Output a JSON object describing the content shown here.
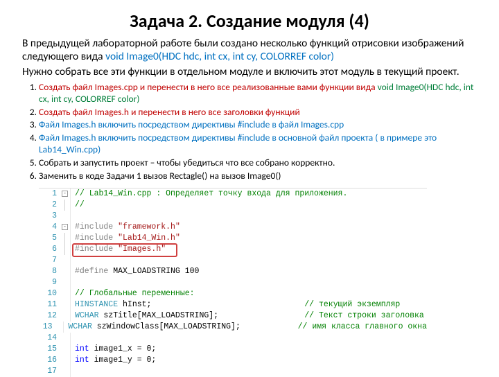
{
  "title": "Задача 2. Создание модуля (4)",
  "intro_part1": "В предыдущей лабораторной работе были создано несколько функций отрисовки изображений следующего вида ",
  "intro_sig": "void Image0(HDC hdc, int cx, int cy, COLORREF color)",
  "intro_part2": "Нужно собрать все эти функции в отдельном модуле и включить этот модуль в текущий проект.",
  "steps": [
    {
      "a": "Создать файл Images.cpp и перенести в него все реализованные вами функции вида ",
      "b": "void Image0(HDC hdc, int cx, int cy, COLORREF color)",
      "cls": "txt-red",
      "bcls": "txt-green"
    },
    {
      "a": "Создать файл Images.h и перенести в него все заголовки функций",
      "cls": "txt-red"
    },
    {
      "a": "Файл Images.h включить посредством директивы #include в файл Images.cpp",
      "cls": "txt-blue"
    },
    {
      "a": "Файл Images.h включить посредством директивы #include в основной файл проекта ( в примере это Lab14_Win.cpp)",
      "cls": "txt-blue"
    },
    {
      "a": "Собрать и запустить проект – чтобы убедиться что все собрано корректно.",
      "cls": "txt-black"
    },
    {
      "a": "Заменить в коде Задачи 1 вызов Rectagle() на вызов Image0()",
      "cls": "txt-black"
    }
  ],
  "chart_data": {
    "type": "table",
    "title": "Code editor snippet – Lab14_Win.cpp",
    "highlight_line": 6,
    "lines": [
      {
        "n": 1,
        "fold": "minus",
        "html": "<span class='c-comment'>// Lab14_Win.cpp : Определяет точку входа для приложения.</span>"
      },
      {
        "n": 2,
        "fold": "v",
        "html": "<span class='c-comment'>//</span>"
      },
      {
        "n": 3,
        "fold": "",
        "html": ""
      },
      {
        "n": 4,
        "fold": "minus",
        "html": "<span class='c-macro'>#include</span> <span class='c-str'>\"framework.h\"</span>"
      },
      {
        "n": 5,
        "fold": "v",
        "html": "<span class='c-macro'>#include</span> <span class='c-str'>\"Lab14_Win.h\"</span>"
      },
      {
        "n": 6,
        "fold": "v",
        "hl": true,
        "html": "<span class='c-macro'>#include</span> <span class='c-str'>\"Images.h\"</span>"
      },
      {
        "n": 7,
        "fold": "",
        "html": ""
      },
      {
        "n": 8,
        "fold": "",
        "html": "<span class='c-macro'>#define</span> MAX_LOADSTRING 100"
      },
      {
        "n": 9,
        "fold": "",
        "html": ""
      },
      {
        "n": 10,
        "fold": "",
        "html": "<span class='c-comment'>// Глобальные переменные:</span>"
      },
      {
        "n": 11,
        "fold": "",
        "html": "<span class='c-type'>HINSTANCE</span> hInst;                                <span class='c-comment'>// текущий экземпляр</span>"
      },
      {
        "n": 12,
        "fold": "",
        "html": "<span class='c-type'>WCHAR</span> szTitle[MAX_LOADSTRING];                  <span class='c-comment'>// Текст строки заголовка</span>"
      },
      {
        "n": 13,
        "fold": "",
        "html": "<span class='c-type'>WCHAR</span> szWindowClass[MAX_LOADSTRING];            <span class='c-comment'>// имя класса главного окна</span>"
      },
      {
        "n": 14,
        "fold": "",
        "html": ""
      },
      {
        "n": 15,
        "fold": "",
        "html": "<span class='c-keyword'>int</span> image1_x = 0;"
      },
      {
        "n": 16,
        "fold": "",
        "html": "<span class='c-keyword'>int</span> image1_y = 0;"
      },
      {
        "n": 17,
        "fold": "",
        "html": ""
      }
    ]
  }
}
